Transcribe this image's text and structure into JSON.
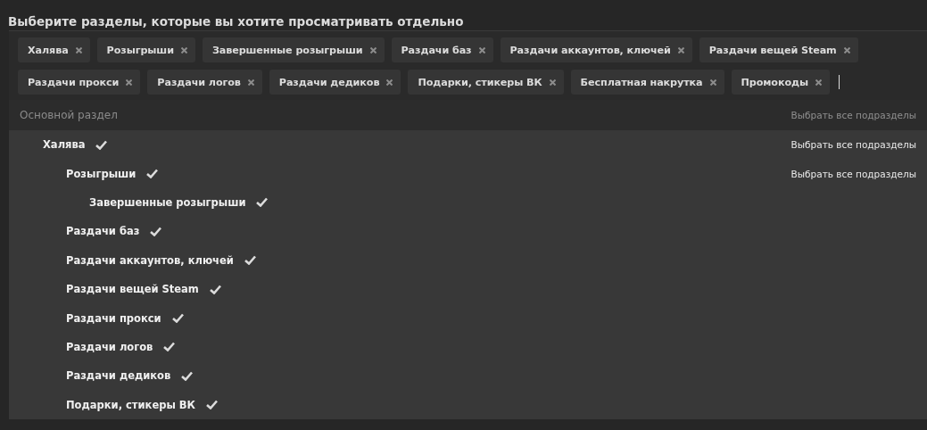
{
  "title": "Выберите разделы, которые вы хотите просматривать отдельно",
  "tags": [
    {
      "label": "Халява"
    },
    {
      "label": "Розыгрыши"
    },
    {
      "label": "Завершенные розыгрыши"
    },
    {
      "label": "Раздачи баз"
    },
    {
      "label": "Раздачи аккаунтов, ключей"
    },
    {
      "label": "Раздачи вещей Steam"
    },
    {
      "label": "Раздачи прокси"
    },
    {
      "label": "Раздачи логов"
    },
    {
      "label": "Раздачи дедиков"
    },
    {
      "label": "Подарки, стикеры ВК"
    },
    {
      "label": "Бесплатная накрутка"
    },
    {
      "label": "Промокоды"
    }
  ],
  "tree": {
    "header": {
      "label": "Основной раздел",
      "select_all": "Выбрать все подразделы"
    },
    "items": [
      {
        "label": "Халява",
        "checked": true,
        "select_all": "Выбрать все подразделы",
        "children": [
          {
            "label": "Розыгрыши",
            "checked": true,
            "select_all": "Выбрать все подразделы",
            "children": [
              {
                "label": "Завершенные розыгрыши",
                "checked": true
              }
            ]
          },
          {
            "label": "Раздачи баз",
            "checked": true
          },
          {
            "label": "Раздачи аккаунтов, ключей",
            "checked": true
          },
          {
            "label": "Раздачи вещей Steam",
            "checked": true
          },
          {
            "label": "Раздачи прокси",
            "checked": true
          },
          {
            "label": "Раздачи логов",
            "checked": true
          },
          {
            "label": "Раздачи дедиков",
            "checked": true
          },
          {
            "label": "Подарки, стикеры ВК",
            "checked": true
          }
        ]
      }
    ]
  }
}
